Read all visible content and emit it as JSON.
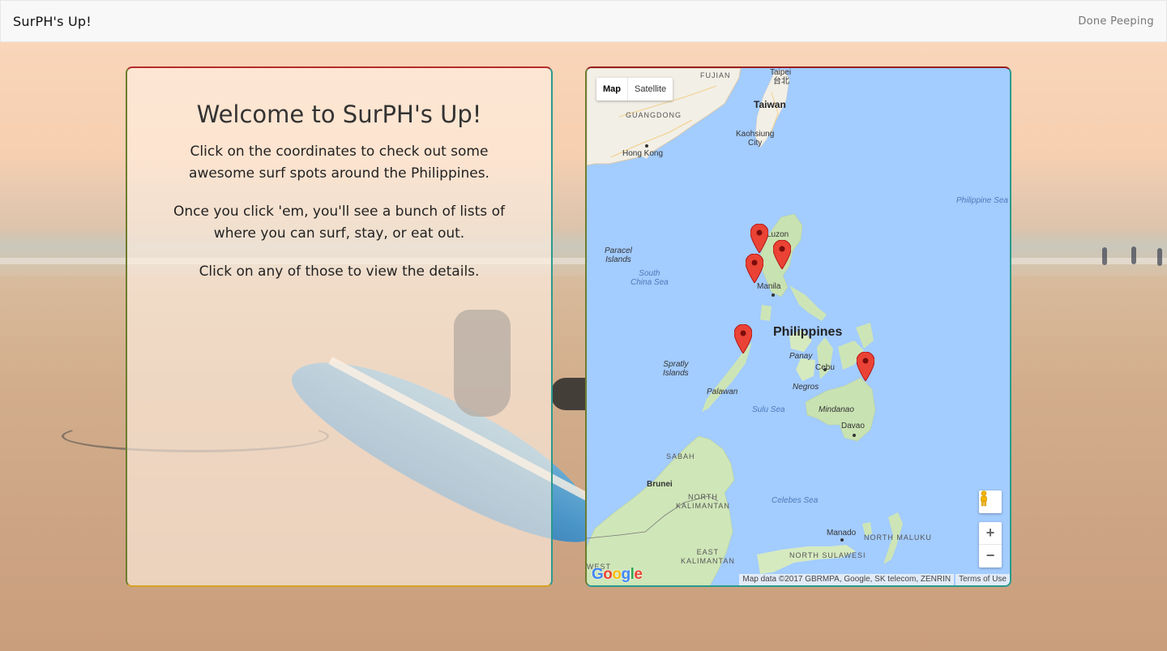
{
  "navbar": {
    "brand": "SurPH's Up!",
    "link": "Done Peeping"
  },
  "welcome": {
    "title": "Welcome to SurPH's Up!",
    "paragraphs": [
      "Click on the coordinates to check out some awesome surf spots around the Philippines.",
      "Once you click 'em, you'll see a bunch of lists of where you can surf, stay, or eat out.",
      "Click on any of those to view the details."
    ]
  },
  "map": {
    "type_control": {
      "map": "Map",
      "satellite": "Satellite",
      "selected": "Map"
    },
    "zoom_in": "+",
    "zoom_out": "−",
    "attribution": "Map data ©2017 GBRMPA, Google, SK telecom, ZENRIN",
    "terms": "Terms of Use",
    "logo": "Google",
    "labels": {
      "fujian": "FUJIAN",
      "taipei": "Taipei",
      "taipei_cn": "台北",
      "taiwan": "Taiwan",
      "guangdong": "GUANGDONG",
      "kaohsiung": "Kaohsiung\nCity",
      "hong_kong": "Hong Kong",
      "philippine_sea": "Philippine Sea",
      "paracel": "Paracel\nIslands",
      "south_china_sea": "South\nChina Sea",
      "luzon": "Luzon",
      "manila": "Manila",
      "philippines": "Philippines",
      "panay": "Panay",
      "cebu": "Cebu",
      "negros": "Negros",
      "mindanao": "Mindanao",
      "spratly": "Spratly\nIslands",
      "palawan": "Palawan",
      "sulu_sea": "Sulu Sea",
      "davao": "Davao",
      "sabah": "SABAH",
      "brunei": "Brunei",
      "north_kalimantan": "NORTH\nKALIMANTAN",
      "celebes_sea": "Celebes Sea",
      "manado": "Manado",
      "north_maluku": "NORTH MALUKU",
      "east_kalimantan": "EAST\nKALIMANTAN",
      "north_sulawesi": "NORTH SULAWESI",
      "west": "WEST"
    },
    "marker_count": 5,
    "marker_color": "#ea4335"
  }
}
